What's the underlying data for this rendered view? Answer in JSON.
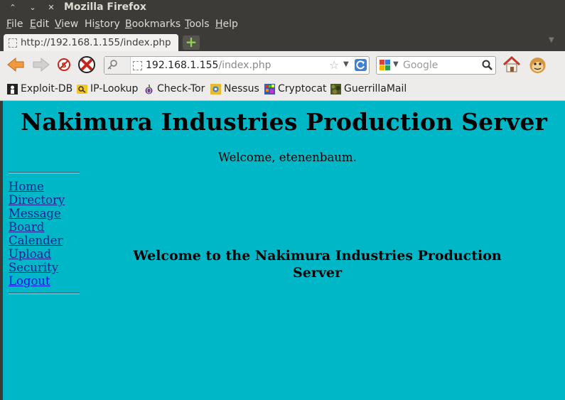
{
  "window": {
    "title": "Mozilla Firefox"
  },
  "menu": [
    {
      "first": "F",
      "rest": "ile"
    },
    {
      "first": "E",
      "rest": "dit"
    },
    {
      "first": "V",
      "rest": "iew"
    },
    {
      "first": "Hi",
      "u": "s",
      "rest": "tory"
    },
    {
      "first": "B",
      "rest": "ookmarks"
    },
    {
      "first": "T",
      "rest": "ools"
    },
    {
      "first": "H",
      "rest": "elp"
    }
  ],
  "tab": {
    "title": "http://192.168.1.155/index.php"
  },
  "urlbar": {
    "host": "192.168.1.155",
    "path": "/index.php"
  },
  "search": {
    "placeholder": "Google"
  },
  "bookmarks": [
    {
      "label": "Exploit-DB",
      "icon": "exploit-db-icon"
    },
    {
      "label": "IP-Lookup",
      "icon": "ip-lookup-icon"
    },
    {
      "label": "Check-Tor",
      "icon": "tor-onion-icon"
    },
    {
      "label": "Nessus",
      "icon": "nessus-icon"
    },
    {
      "label": "Cryptocat",
      "icon": "cryptocat-icon"
    },
    {
      "label": "GuerrillaMail",
      "icon": "guerrillamail-icon"
    }
  ],
  "page": {
    "heading": "Nakimura Industries Production Server",
    "welcome": "Welcome, etenenbaum.",
    "nav": [
      "Home",
      "Directory",
      "Message",
      "Board",
      "Calender",
      "Upload",
      "Security",
      "Logout"
    ],
    "main_message": "Welcome to the Nakimura Industries Production Server",
    "background": "#00b7c7"
  }
}
